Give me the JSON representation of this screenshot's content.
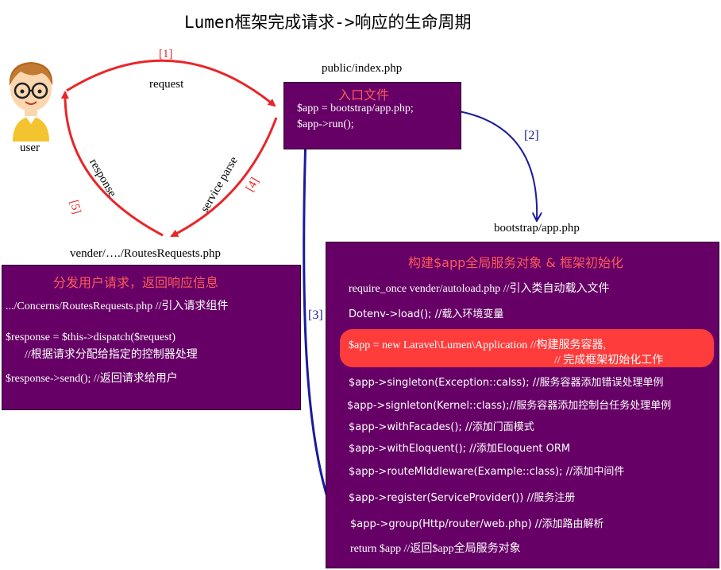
{
  "title": "Lumen框架完成请求->响应的生命周期",
  "user": {
    "label": "user"
  },
  "arrows": {
    "step1": "[1]",
    "request": "request",
    "step2": "[2]",
    "step3": "[3]",
    "step4": "[4]",
    "step5": "[5]",
    "service_parse": "service parse",
    "response": "response"
  },
  "index_box": {
    "file": "public/index.php",
    "heading": "入口文件",
    "line1": "$app = bootstrap/app.php;",
    "line2": "$app->run();"
  },
  "routes_box": {
    "file": "vender/…./RoutesRequests.php",
    "heading": "分发用户请求，返回响应信息",
    "line1": ".../Concerns/RoutesRequests.php    //引入请求组件",
    "line2": "$response = $this->dispatch($request)",
    "line3": "//根据请求分配给指定的控制器处理",
    "line4": "$response->send();        //返回请求给用户"
  },
  "app_box": {
    "file": "bootstrap/app.php",
    "heading": "构建$app全局服务对象 & 框架初始化",
    "lines": [
      "require_once vender/autoload.php   //引入类自动载入文件",
      "Dotenv->load();      //载入环境变量",
      "$app = new Laravel\\Lumen\\Application      //构建服务容器,",
      "// 完成框架初始化工作",
      "$app->singleton(Exception::calss);     //服务容器添加错误处理单例",
      "$app->signleton(Kernel::class);//服务容器添加控制台任务处理单例",
      "$app->withFacades();      //添加门面模式",
      "$app->withEloquent();      //添加Eloquent ORM",
      "$app->routeMIddleware(Example::class);   //添加中间件",
      "$app->register(ServiceProvider())    //服务注册",
      "$app->group(Http/router/web.php)    //添加路由解析",
      "return  $app     //返回$app全局服务对象"
    ]
  },
  "colors": {
    "box": "#660066",
    "accent_red": "#e8262a",
    "arrow_blue": "#1a1a9e",
    "highlight": "#ff3c3c"
  }
}
